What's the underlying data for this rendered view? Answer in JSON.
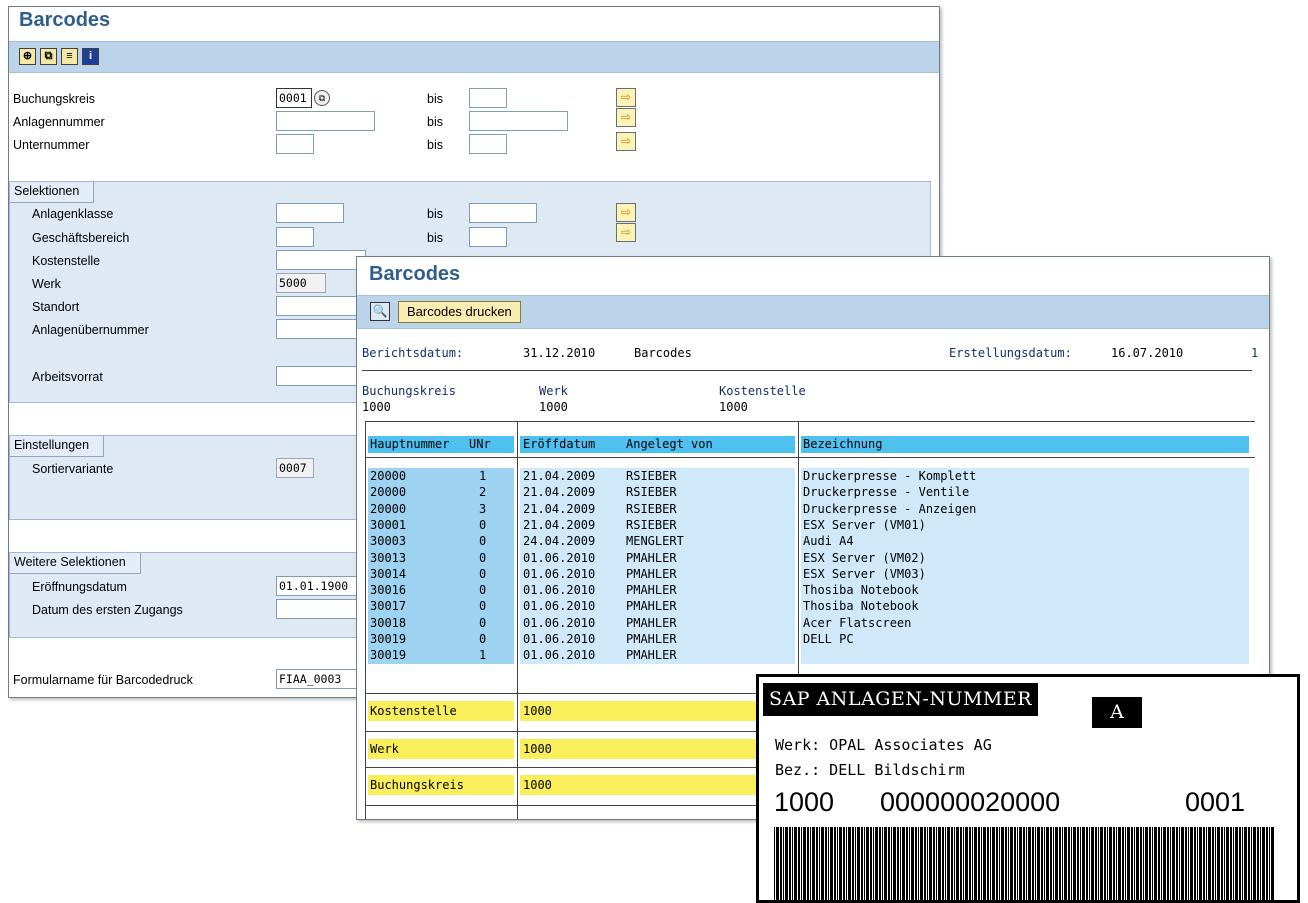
{
  "selection_window": {
    "title": "Barcodes",
    "fields": [
      {
        "label": "Buchungskreis",
        "value": "0001",
        "to_label": "bis"
      },
      {
        "label": "Anlagennummer",
        "value": "",
        "to_label": "bis"
      },
      {
        "label": "Unternummer",
        "value": "",
        "to_label": "bis"
      }
    ],
    "groups": {
      "selektionen": {
        "title": "Selektionen",
        "fields": [
          {
            "label": "Anlagenklasse",
            "value": "",
            "to_label": "bis"
          },
          {
            "label": "Geschäftsbereich",
            "value": "",
            "to_label": "bis"
          },
          {
            "label": "Kostenstelle",
            "value": ""
          },
          {
            "label": "Werk",
            "value": "5000"
          },
          {
            "label": "Standort",
            "value": ""
          },
          {
            "label": "Anlagenübernummer",
            "value": ""
          },
          {
            "label": "Arbeitsvorrat",
            "value": ""
          }
        ]
      },
      "einstellungen": {
        "title": "Einstellungen",
        "fields": [
          {
            "label": "Sortiervariante",
            "value": "0007"
          }
        ]
      },
      "weitere": {
        "title": "Weitere Selektionen",
        "fields": [
          {
            "label": "Eröffnungsdatum",
            "value": "01.01.1900"
          },
          {
            "label": "Datum des ersten Zugangs",
            "value": ""
          }
        ]
      }
    },
    "form_field": {
      "label": "Formularname für Barcodedruck",
      "value": "FIAA_0003"
    }
  },
  "report_window": {
    "title": "Barcodes",
    "print_button": "Barcodes drucken",
    "header": {
      "berichtsdatum_label": "Berichtsdatum:",
      "berichtsdatum": "31.12.2010",
      "report_name": "Barcodes",
      "erstellungsdatum_label": "Erstellungsdatum:",
      "erstellungsdatum": "16.07.2010",
      "page": "1"
    },
    "criteria_labels": [
      "Buchungskreis",
      "Werk",
      "Kostenstelle"
    ],
    "criteria_values": [
      "1000",
      "1000",
      "1000"
    ],
    "columns": [
      "Hauptnummer",
      "UNr",
      "Eröffdatum",
      "Angelegt von",
      "Bezeichnung"
    ],
    "rows": [
      {
        "main": "20000",
        "sub": "1",
        "date": "21.04.2009",
        "user": "RSIEBER",
        "desc": "Druckerpresse - Komplett"
      },
      {
        "main": "20000",
        "sub": "2",
        "date": "21.04.2009",
        "user": "RSIEBER",
        "desc": "Druckerpresse - Ventile"
      },
      {
        "main": "20000",
        "sub": "3",
        "date": "21.04.2009",
        "user": "RSIEBER",
        "desc": "Druckerpresse - Anzeigen"
      },
      {
        "main": "30001",
        "sub": "0",
        "date": "21.04.2009",
        "user": "RSIEBER",
        "desc": "ESX Server (VM01)"
      },
      {
        "main": "30003",
        "sub": "0",
        "date": "24.04.2009",
        "user": "MENGLERT",
        "desc": "Audi A4"
      },
      {
        "main": "30013",
        "sub": "0",
        "date": "01.06.2010",
        "user": "PMAHLER",
        "desc": "ESX Server (VM02)"
      },
      {
        "main": "30014",
        "sub": "0",
        "date": "01.06.2010",
        "user": "PMAHLER",
        "desc": "ESX Server (VM03)"
      },
      {
        "main": "30016",
        "sub": "0",
        "date": "01.06.2010",
        "user": "PMAHLER",
        "desc": "Thosiba Notebook"
      },
      {
        "main": "30017",
        "sub": "0",
        "date": "01.06.2010",
        "user": "PMAHLER",
        "desc": "Thosiba Notebook"
      },
      {
        "main": "30018",
        "sub": "0",
        "date": "01.06.2010",
        "user": "PMAHLER",
        "desc": "Acer Flatscreen"
      },
      {
        "main": "30019",
        "sub": "0",
        "date": "01.06.2010",
        "user": "PMAHLER",
        "desc": "DELL PC"
      },
      {
        "main": "30019",
        "sub": "1",
        "date": "01.06.2010",
        "user": "PMAHLER",
        "desc": ""
      }
    ],
    "totals": [
      {
        "label": "Kostenstelle",
        "value": "1000"
      },
      {
        "label": "Werk",
        "value": "1000"
      },
      {
        "label": "Buchungskreis",
        "value": "1000"
      }
    ]
  },
  "barcode_label": {
    "header": "SAP ANLAGEN-NUMMER",
    "class_letter": "A",
    "werk_line": "Werk: OPAL Associates AG",
    "bez_line": "Bez.: DELL Bildschirm",
    "company_code": "1000",
    "asset_number": "000000020000",
    "sub_number": "0001"
  },
  "colors": {
    "title": "#2e5e8c",
    "toolbar": "#bcd4ea",
    "group_bg": "#dfe9f4",
    "table_header": "#4ec1f0",
    "row_main": "#9dd3f1",
    "row_other": "#cfe9fb",
    "totals": "#f9ef5a"
  }
}
